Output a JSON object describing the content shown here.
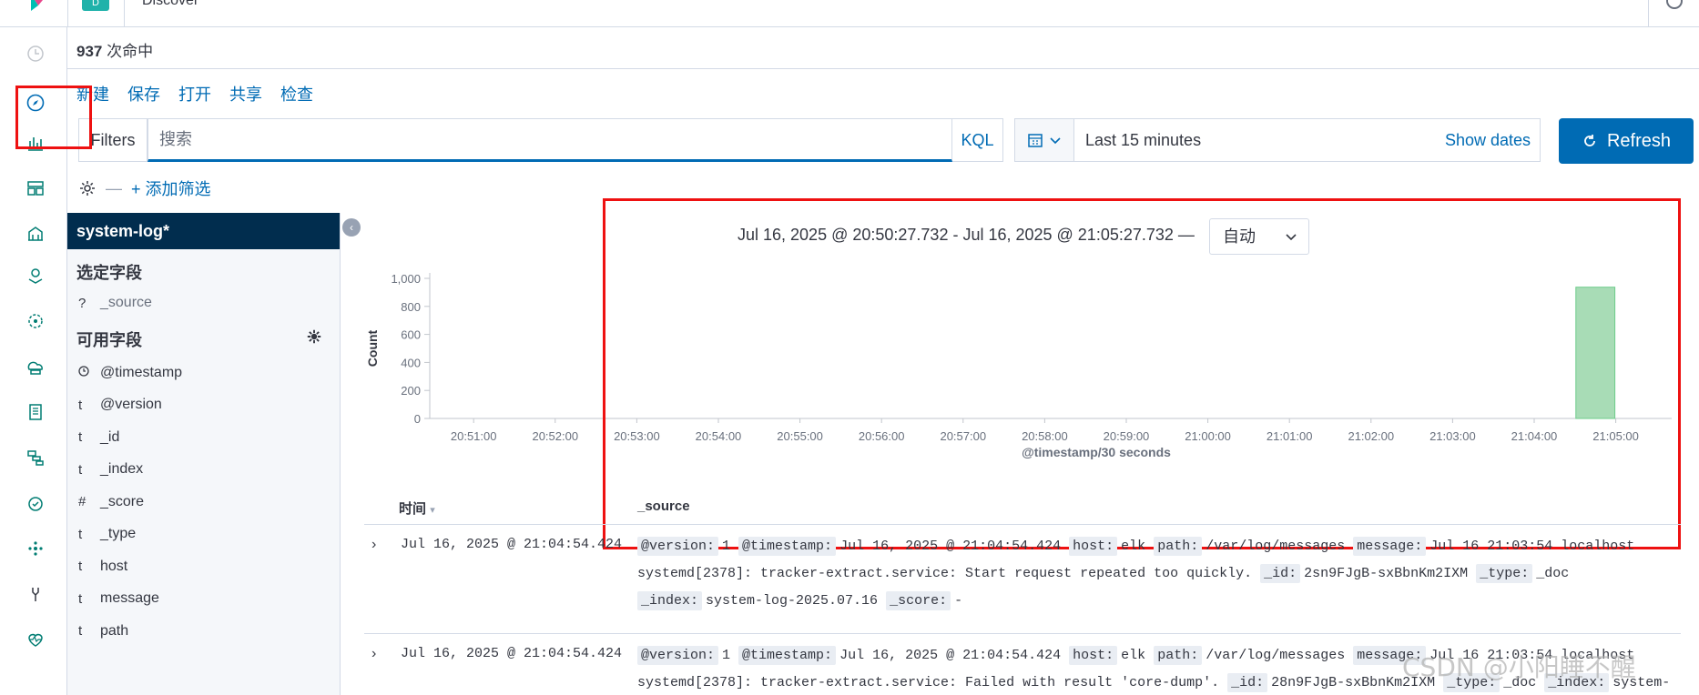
{
  "topbar": {
    "app_badge": "D",
    "app_title": "Discover"
  },
  "hits": {
    "count": "937",
    "suffix": " 次命中"
  },
  "menu": [
    "新建",
    "保存",
    "打开",
    "共享",
    "检查"
  ],
  "query": {
    "filters_label": "Filters",
    "placeholder": "搜索",
    "language": "KQL"
  },
  "time": {
    "range": "Last 15 minutes",
    "show_dates": "Show dates",
    "refresh": "Refresh"
  },
  "filter_bar": {
    "add_filter": "+ 添加筛选"
  },
  "sidebar": {
    "index_pattern": "system-log*",
    "selected_heading": "选定字段",
    "selected_fields": [
      {
        "type": "?",
        "name": "_source"
      }
    ],
    "available_heading": "可用字段",
    "available_fields": [
      {
        "type": "clock",
        "name": "@timestamp"
      },
      {
        "type": "t",
        "name": "@version"
      },
      {
        "type": "t",
        "name": "_id"
      },
      {
        "type": "t",
        "name": "_index"
      },
      {
        "type": "#",
        "name": "_score"
      },
      {
        "type": "t",
        "name": "_type"
      },
      {
        "type": "t",
        "name": "host"
      },
      {
        "type": "t",
        "name": "message"
      },
      {
        "type": "t",
        "name": "path"
      }
    ]
  },
  "chart_header": {
    "range": "Jul 16, 2025 @ 20:50:27.732 - Jul 16, 2025 @ 21:05:27.732 —",
    "interval": "自动"
  },
  "chart_data": {
    "type": "bar",
    "ylabel": "Count",
    "xlabel": "@timestamp/30 seconds",
    "ylim": [
      0,
      1000
    ],
    "yticks": [
      0,
      200,
      400,
      600,
      800,
      1000
    ],
    "ytick_labels": [
      "0",
      "200",
      "400",
      "600",
      "800",
      "1,000"
    ],
    "xticks": [
      "20:51:00",
      "20:52:00",
      "20:53:00",
      "20:54:00",
      "20:55:00",
      "20:56:00",
      "20:57:00",
      "20:58:00",
      "20:59:00",
      "21:00:00",
      "21:01:00",
      "21:02:00",
      "21:03:00",
      "21:04:00",
      "21:05:00"
    ],
    "categories": [
      "21:04:30"
    ],
    "values": [
      937
    ],
    "bar_color": "#a8dcb6"
  },
  "table": {
    "col_time": "时间",
    "col_source": "_source",
    "rows": [
      {
        "time": "Jul 16, 2025 @ 21:04:54.424",
        "line1": [
          [
            "@version:",
            "1"
          ],
          [
            "@timestamp:",
            "Jul 16, 2025 @ 21:04:54.424"
          ],
          [
            "host:",
            "elk"
          ],
          [
            "path:",
            "/var/log/messages"
          ],
          [
            "message:",
            "Jul 16 21:03:54 localhost"
          ]
        ],
        "line2": "systemd[2378]: tracker-extract.service: Start request repeated too quickly.",
        "line2_pairs": [
          [
            "_id:",
            "2sn9FJgB-sxBbnKm2IXM"
          ],
          [
            "_type:",
            "_doc"
          ]
        ],
        "line3_pairs": [
          [
            "_index:",
            "system-log-2025.07.16"
          ],
          [
            "_score:",
            "-"
          ]
        ]
      },
      {
        "time": "Jul 16, 2025 @ 21:04:54.424",
        "line1": [
          [
            "@version:",
            "1"
          ],
          [
            "@timestamp:",
            "Jul 16, 2025 @ 21:04:54.424"
          ],
          [
            "host:",
            "elk"
          ],
          [
            "path:",
            "/var/log/messages"
          ],
          [
            "message:",
            "Jul 16 21:03:54 localhost"
          ]
        ],
        "line2": "systemd[2378]: tracker-extract.service: Failed with result 'core-dump'.",
        "line2_pairs": [
          [
            "_id:",
            "28n9FJgB-sxBbnKm2IXM"
          ],
          [
            "_type:",
            "_doc"
          ],
          [
            "_index:",
            "system-"
          ]
        ]
      }
    ]
  },
  "watermark": "CSDN @小阳睡不醒"
}
